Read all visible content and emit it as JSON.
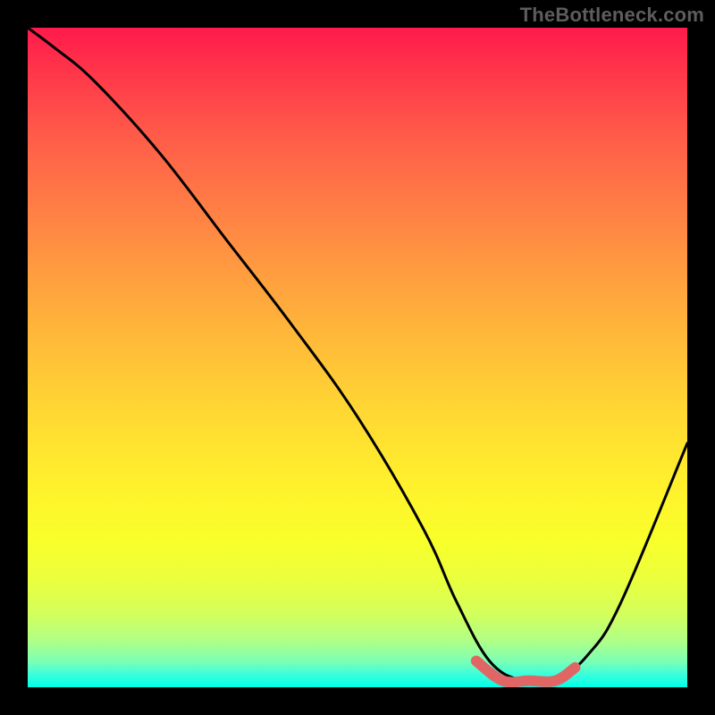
{
  "watermark": "TheBottleneck.com",
  "chart_data": {
    "type": "line",
    "title": "",
    "xlabel": "",
    "ylabel": "",
    "xlim": [
      0,
      100
    ],
    "ylim": [
      0,
      100
    ],
    "series": [
      {
        "name": "bottleneck-curve",
        "x": [
          0,
          4,
          10,
          20,
          30,
          40,
          50,
          60,
          65,
          70,
          75,
          80,
          85,
          90,
          100
        ],
        "values": [
          100,
          97,
          92,
          81,
          68,
          55,
          41,
          24,
          13,
          4,
          1,
          1,
          5,
          13,
          37
        ]
      },
      {
        "name": "optimal-range-highlight",
        "x": [
          68,
          72,
          76,
          80,
          83
        ],
        "values": [
          4,
          1,
          1,
          1,
          3
        ]
      }
    ],
    "background_gradient": {
      "top": "#ff1a4b",
      "mid_upper": "#ff9940",
      "mid": "#fff22c",
      "mid_lower": "#afff88",
      "bottom": "#00ffea"
    }
  }
}
